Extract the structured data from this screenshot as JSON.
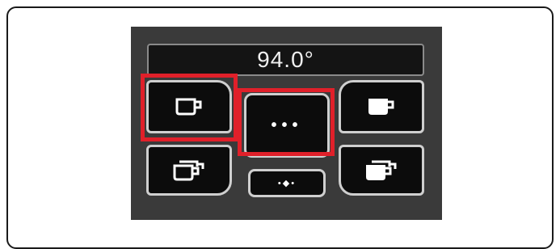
{
  "display": {
    "temperature": "94.0°"
  },
  "buttons": {
    "single_cup": {
      "icon": "single-cup-icon"
    },
    "menu": {
      "label": "•••",
      "icon": "ellipsis-icon"
    },
    "large_cup": {
      "icon": "large-cup-icon"
    },
    "double_cup": {
      "icon": "double-cup-icon"
    },
    "water_dispense": {
      "label": "•◆•",
      "icon": "water-drops-icon"
    },
    "double_large_cup": {
      "icon": "double-large-cup-icon"
    }
  },
  "highlights": {
    "color": "#e0202a"
  }
}
